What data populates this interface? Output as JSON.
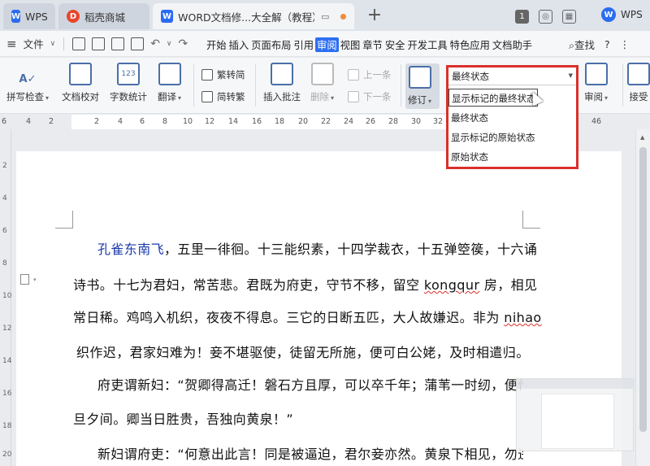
{
  "tabs": [
    {
      "label": "WPS"
    },
    {
      "label": "稻壳商城"
    },
    {
      "label": "WORD文档修...大全解（教程）"
    }
  ],
  "titlebar": {
    "page_num": "1",
    "user_label": "WPS"
  },
  "menubar": {
    "file_label": "文件",
    "menus": [
      "开始",
      "插入",
      "页面布局",
      "引用",
      "审阅",
      "视图",
      "章节",
      "安全",
      "开发工具",
      "特色应用",
      "文档助手"
    ],
    "active_menu": "审阅",
    "search_label": "查找",
    "help_label": "?"
  },
  "ribbon": {
    "spellcheck": "拼写检查",
    "proofread": "文档校对",
    "wordcount": "字数统计",
    "translate": "翻译",
    "to_traditional": "繁转简",
    "to_simplified": "简转繁",
    "insert_comment": "插入批注",
    "delete": "删除",
    "prev": "上一条",
    "next": "下一条",
    "revise": "修订",
    "review": "审阅",
    "accept": "接受",
    "wordcount_icon": "123"
  },
  "display_mode": {
    "selected": "最终状态",
    "highlighted": "显示标记的最终状态",
    "options": [
      "最终状态",
      "显示标记的原始状态",
      "原始状态"
    ]
  },
  "ruler": {
    "ticks": [
      "6",
      "4",
      "2",
      "2",
      "4",
      "6",
      "8",
      "10",
      "12",
      "14",
      "16",
      "18",
      "20",
      "22",
      "24",
      "26",
      "28",
      "30",
      "32",
      "46"
    ]
  },
  "vruler": {
    "ticks": [
      "2",
      "4",
      "6",
      "8",
      "10",
      "12",
      "14",
      "16",
      "18",
      "20"
    ]
  },
  "document": {
    "line1_blue": "孔雀东南飞",
    "line1_rest": "，五里一徘徊。十三能织素，十四学裁衣，十五弹箜篌，十六诵",
    "line2_a": "诗书。十七为君妇，常苦悲。君既为府吏，守节不移，留空 ",
    "line2_squig": "kongqur",
    "line2_b": " 房，相见",
    "line3_a": "常日稀。鸡鸣入机织，夜夜不得息。三它的日断五匹，大人故嫌迟。非为 ",
    "line3_squig": "nihao",
    "line4": "织作迟，君家妇难为！妾不堪驱使，徒留无所施，便可白公姥，及时相遣归。",
    "line5": "府吏谓新妇：“贺卿得高迁！磐石方且厚，可以卒千年；蒲苇一时纫，便作",
    "line6": "旦夕间。卿当日胜贵，吾独向黄泉！”",
    "line7": "新妇谓府吏：“何意出此言！同是被逼迫，君尔妾亦然。黄泉下相见，勿违"
  }
}
